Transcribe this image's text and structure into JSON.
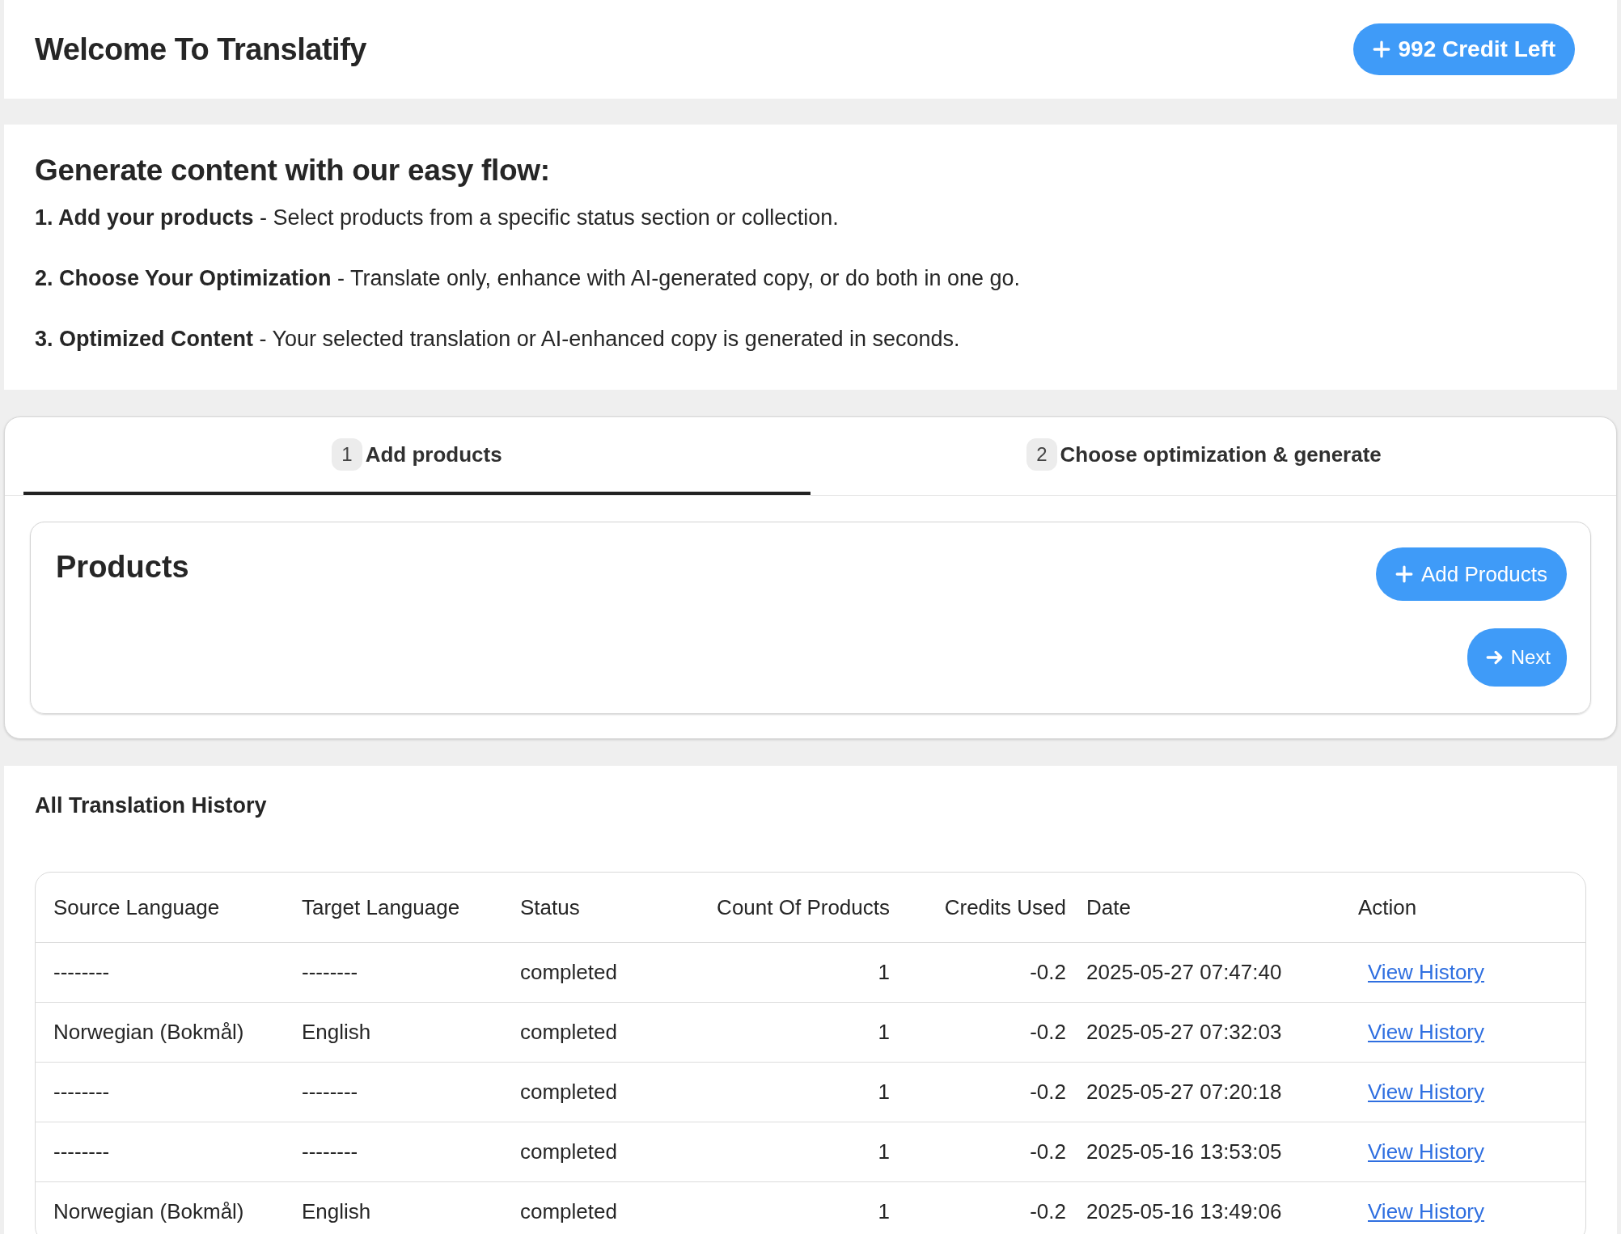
{
  "header": {
    "title": "Welcome To Translatify",
    "credit_button": "992 Credit Left"
  },
  "flow": {
    "heading": "Generate content with our easy flow:",
    "steps": [
      {
        "text": "**1. Add your products** - Select products from a specific status section or collection."
      },
      {
        "text": "**2. Choose Your Optimization** - Translate only, enhance with AI-generated copy, or do both in one go."
      },
      {
        "text": "**3. Optimized Content** - Your selected translation or AI-enhanced copy is generated in seconds."
      }
    ]
  },
  "tabs": [
    {
      "number": "1",
      "label": "Add products",
      "selected": true
    },
    {
      "number": "2",
      "label": "Choose optimization & generate",
      "selected": false
    }
  ],
  "products": {
    "title": "Products",
    "add_button": "Add Products",
    "next_button": "Next"
  },
  "history": {
    "title": "All Translation History",
    "columns": [
      "Source Language",
      "Target Language",
      "Status",
      "Count Of Products",
      "Credits Used",
      "Date",
      "Action"
    ],
    "rows": [
      [
        "--------",
        "--------",
        "completed",
        "1",
        "-0.2",
        "2025-05-27 07:47:40",
        "View History"
      ],
      [
        "Norwegian (Bokmål)",
        "English",
        "completed",
        "1",
        "-0.2",
        "2025-05-27 07:32:03",
        "View History"
      ],
      [
        "--------",
        "--------",
        "completed",
        "1",
        "-0.2",
        "2025-05-27 07:20:18",
        "View History"
      ],
      [
        "--------",
        "--------",
        "completed",
        "1",
        "-0.2",
        "2025-05-16 13:53:05",
        "View History"
      ],
      [
        "Norwegian (Bokmål)",
        "English",
        "completed",
        "1",
        "-0.2",
        "2025-05-16 13:49:06",
        "View History"
      ]
    ]
  }
}
